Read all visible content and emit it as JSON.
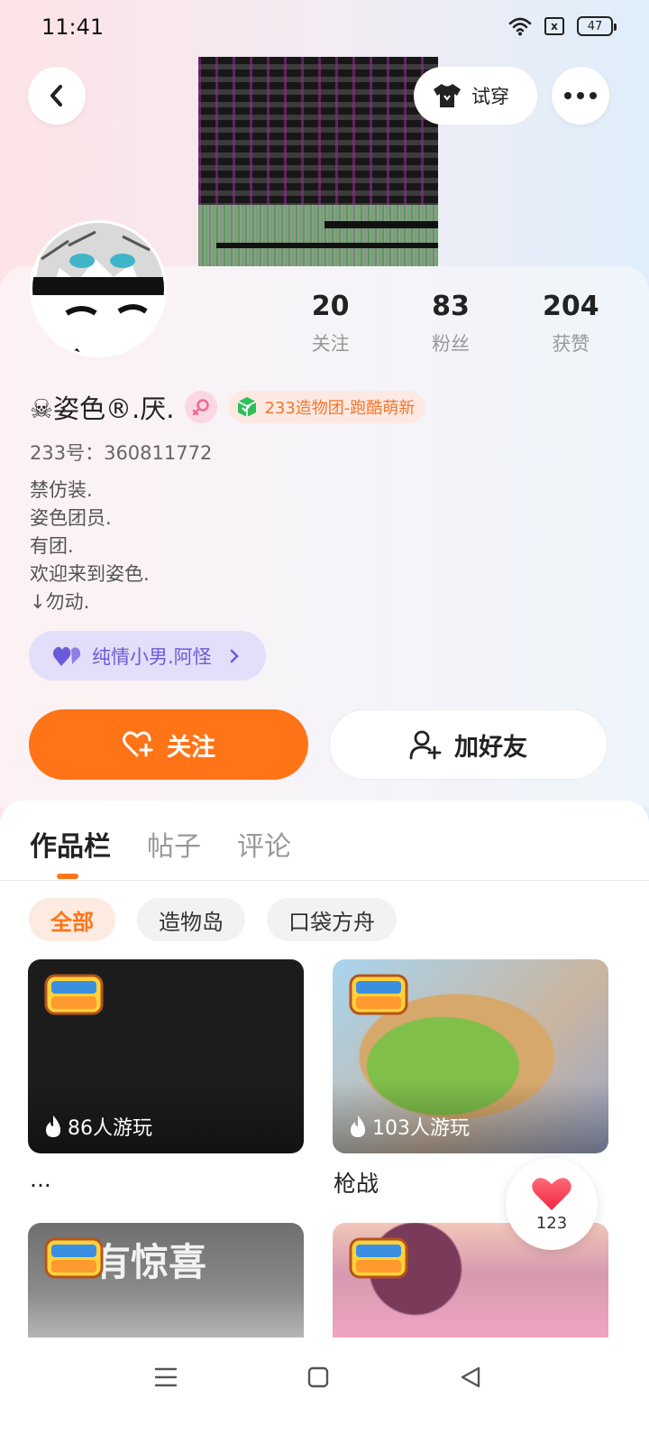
{
  "status_bar": {
    "time": "11:41",
    "battery": "47",
    "sim": "x"
  },
  "header": {
    "try_on_label": "试穿"
  },
  "stats": [
    {
      "value": "20",
      "label": "关注"
    },
    {
      "value": "83",
      "label": "粉丝"
    },
    {
      "value": "204",
      "label": "获赞"
    }
  ],
  "profile": {
    "username": "☠姿色®.厌.",
    "tag": "233造物团-跑酷萌新",
    "uid": "233号：360811772",
    "bio": [
      "禁仿装.",
      "姿色团员.",
      "有团.",
      "欢迎来到姿色.",
      "↓勿动."
    ],
    "relation": "纯情小男.阿怪"
  },
  "actions": {
    "follow_label": "关注",
    "add_friend_label": "加好友"
  },
  "tabs": [
    "作品栏",
    "帖子",
    "评论"
  ],
  "filters": [
    "全部",
    "造物岛",
    "口袋方舟"
  ],
  "cards": [
    {
      "badge": "233造物岛",
      "players": "86人游玩",
      "title": "..."
    },
    {
      "badge": "233造物岛",
      "players": "103人游玩",
      "title": "枪战"
    },
    {
      "badge": "233造物岛",
      "overlay_text": "一有惊喜"
    },
    {
      "badge": "233造物岛"
    }
  ],
  "like": {
    "count": "123"
  },
  "colors": {
    "accent": "#ff7417",
    "relation": "#6c5bd8",
    "tag": "#f2772c"
  }
}
